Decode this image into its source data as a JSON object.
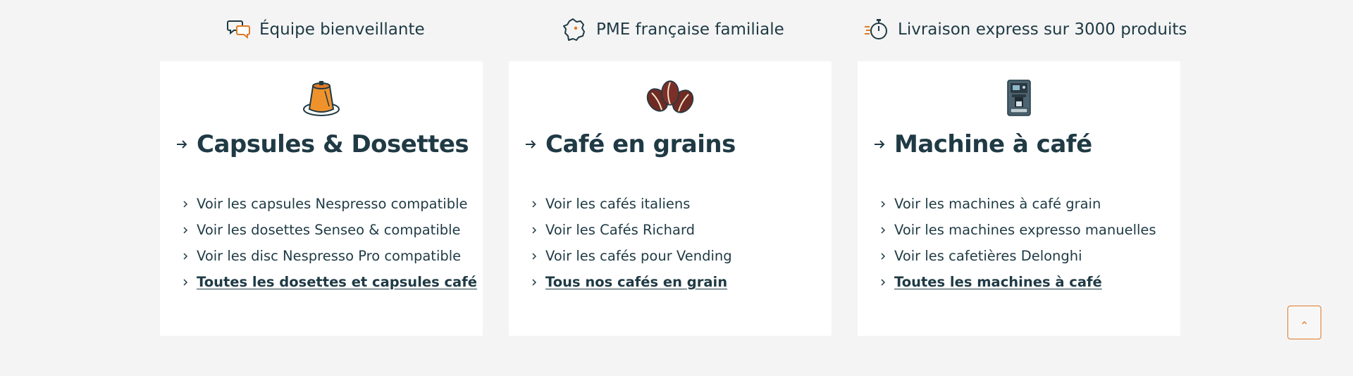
{
  "features": [
    {
      "label": "Équipe bienveillante",
      "icon": "chat-bubbles-icon"
    },
    {
      "label": "PME française familiale",
      "icon": "france-map-icon"
    },
    {
      "label": "Livraison express sur 3000 produits",
      "icon": "fast-stopwatch-icon"
    }
  ],
  "cards": [
    {
      "title": "Capsules & Dosettes",
      "icon": "coffee-capsule-icon",
      "links": [
        "Voir les capsules Nespresso compatible",
        "Voir les dosettes Senseo & compatible",
        "Voir les disc Nespresso Pro compatible",
        "Toutes les dosettes et capsules café"
      ]
    },
    {
      "title": "Café en grains",
      "icon": "coffee-beans-icon",
      "links": [
        "Voir les cafés italiens",
        "Voir les Cafés Richard",
        "Voir les cafés pour Vending",
        "Tous nos cafés en grain"
      ]
    },
    {
      "title": "Machine à café",
      "icon": "coffee-machine-icon",
      "links": [
        "Voir les machines à café grain",
        "Voir les machines expresso manuelles",
        "Voir les cafetières Delonghi",
        "Toutes les machines à café"
      ]
    }
  ],
  "back_to_top": {
    "icon": "chevron-up-icon"
  },
  "colors": {
    "text": "#1f3a44",
    "accent": "#e07a24",
    "card_background": "#ffffff",
    "page_background": "#f4f4f4",
    "bean": "#6e2b24"
  }
}
